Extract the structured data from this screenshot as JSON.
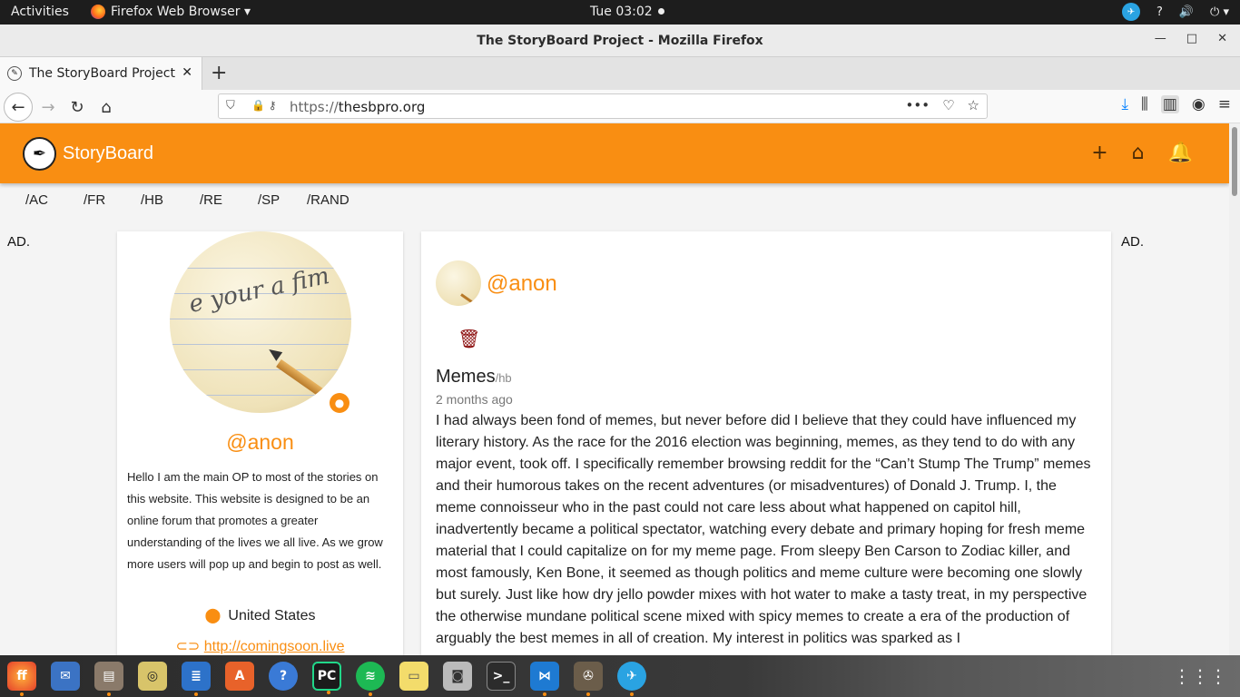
{
  "system": {
    "activities": "Activities",
    "app_menu": "Firefox Web Browser ▾",
    "clock": "Tue 03:02",
    "tray": [
      "?",
      "🔊",
      "⏻ ▾"
    ]
  },
  "window": {
    "title": "The StoryBoard Project - Mozilla Firefox"
  },
  "tab": {
    "title": "The StoryBoard Project"
  },
  "navbar": {
    "url_scheme": "https://",
    "url_host": "thesbpro.org"
  },
  "site": {
    "brand": "StoryBoard",
    "categories": [
      "/AC",
      "/FR",
      "/HB",
      "/RE",
      "/SP",
      "/RAND"
    ],
    "ad_left": "AD.",
    "ad_right": "AD."
  },
  "profile": {
    "username": "@anon",
    "bio": "Hello I am the main OP to most of the stories on this website. This website is designed to be an online forum that promotes a greater understanding of the lives we all live. As we grow more users will pop up and begin to post as well.",
    "location": "United States",
    "link": "http://comingsoon.live"
  },
  "post": {
    "username": "@anon",
    "title": "Memes",
    "tag": "/hb",
    "time": "2 months ago",
    "body": "I had always been fond of memes, but never before did I believe that they could have influenced my literary history. As the race for the 2016 election was beginning, memes, as they tend to do with any major event, took off. I specifically remember browsing reddit for the “Can’t Stump The Trump” memes and their humorous takes on the recent adventures (or misadventures) of Donald J. Trump. I, the meme connoisseur who in the past could not care less about what happened on capitol hill, inadvertently became a political spectator, watching every debate and primary hoping for fresh meme material that I could capitalize on for my meme page. From sleepy Ben Carson to Zodiac killer, and most famously, Ken Bone, it seemed as though politics and meme culture were becoming one slowly but surely. Just like how dry jello powder mixes with hot water to make a tasty treat, in my perspective the otherwise mundane political scene mixed with spicy memes to create a era of the production of arguably the best memes in all of creation. My interest in politics was sparked as I"
  },
  "colors": {
    "accent": "#f98e12",
    "danger": "#8b0d0d"
  },
  "dock": [
    "firefox",
    "thunderbird",
    "files",
    "rhythmbox",
    "writer",
    "software",
    "help",
    "pycharm",
    "spotify",
    "notes",
    "screenshot",
    "terminal",
    "vscode",
    "gimp",
    "telegram"
  ]
}
